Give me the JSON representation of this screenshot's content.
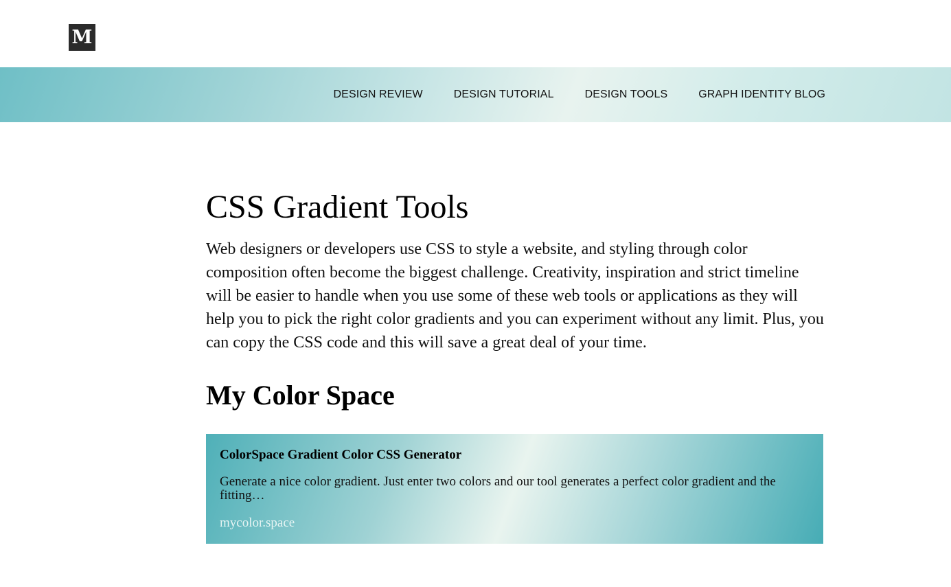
{
  "header": {
    "logo_letter": "M",
    "logo_icon": "medium-logo-icon"
  },
  "nav": {
    "items": [
      {
        "label": "DESIGN REVIEW"
      },
      {
        "label": "DESIGN TUTORIAL"
      },
      {
        "label": "DESIGN TOOLS"
      },
      {
        "label": "GRAPH IDENTITY BLOG"
      }
    ],
    "gradient_colors": [
      "#6fbfc6",
      "#e8f3ef",
      "#c2e4e3"
    ]
  },
  "article": {
    "title": "CSS Gradient Tools",
    "intro": "Web designers or developers use CSS to style a website, and styling through color composition often become the biggest challenge. Creativity, inspiration and strict timeline will be easier to handle when you use some of these web tools or applications as they will help you to pick the right color gradients and you can experiment without any limit. Plus, you can copy the CSS code and this will save a great deal of your time.",
    "section_heading": "My Color Space"
  },
  "card": {
    "title": "ColorSpace Gradient Color CSS Generator",
    "description": "Generate a nice color gradient. Just enter two colors and our tool generates a perfect color gradient and the fitting…",
    "domain": "mycolor.space",
    "gradient_colors": [
      "#4fb0b8",
      "#e9f4ef",
      "#46acb5"
    ]
  }
}
